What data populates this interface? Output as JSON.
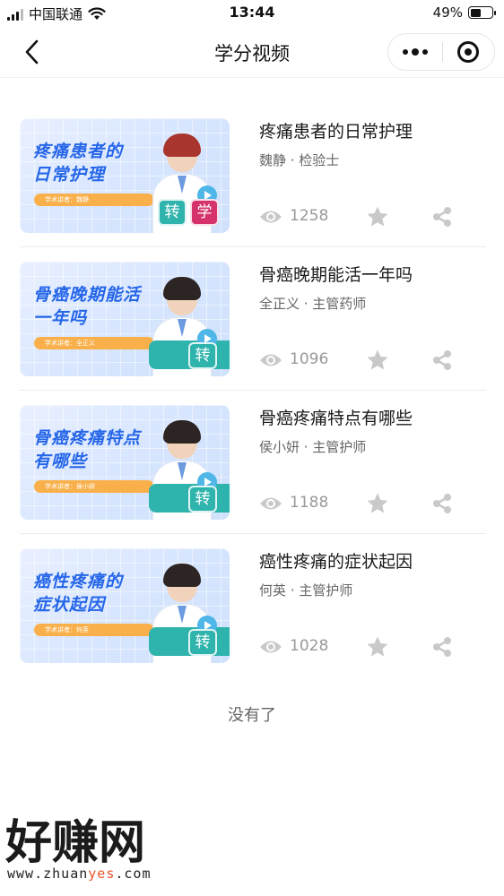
{
  "status_bar": {
    "carrier": "中国联通",
    "time": "13:44",
    "battery_percent": "49%",
    "battery_level": 0.49,
    "icons": [
      "signal-icon",
      "wifi-icon",
      "battery-icon"
    ]
  },
  "nav": {
    "title": "学分视频",
    "back_icon": "chevron-left-icon",
    "more_icon": "more-dots-icon",
    "close_icon": "target-circle-icon"
  },
  "videos": [
    {
      "title": "疼痛患者的日常护理",
      "author": "魏静 · 检验士",
      "views": "1258",
      "thumb": {
        "title_line1": "疼痛患者的",
        "title_line2": "日常护理",
        "lecturer": "学术讲者：魏静",
        "tags": [
          "转",
          "学"
        ]
      }
    },
    {
      "title": "骨癌晚期能活一年吗",
      "author": "全正义 · 主管药师",
      "views": "1096",
      "thumb": {
        "title_line1": "骨癌晚期能活",
        "title_line2": "一年吗",
        "lecturer": "学术讲者：全正义",
        "tags": [
          "转"
        ]
      }
    },
    {
      "title": "骨癌疼痛特点有哪些",
      "author": "侯小妍 · 主管护师",
      "views": "1188",
      "thumb": {
        "title_line1": "骨癌疼痛特点",
        "title_line2": "有哪些",
        "lecturer": "学术讲者：侯小妍",
        "tags": [
          "转"
        ]
      }
    },
    {
      "title": "癌性疼痛的症状起因",
      "author": "何英 · 主管护师",
      "views": "1028",
      "thumb": {
        "title_line1": "癌性疼痛的",
        "title_line2": "症状起因",
        "lecturer": "学术讲者：何英",
        "tags": [
          "转"
        ]
      }
    }
  ],
  "end_text": "没有了",
  "watermark": {
    "main": "好赚网",
    "url_prefix": "www.zhuan",
    "url_highlight": "yes",
    "url_suffix": ".com"
  },
  "colors": {
    "accent_blue": "#2566e8",
    "teal": "#2fb4ad",
    "pink": "#d5316a",
    "orange": "#f9b04b",
    "gray": "#999999"
  }
}
